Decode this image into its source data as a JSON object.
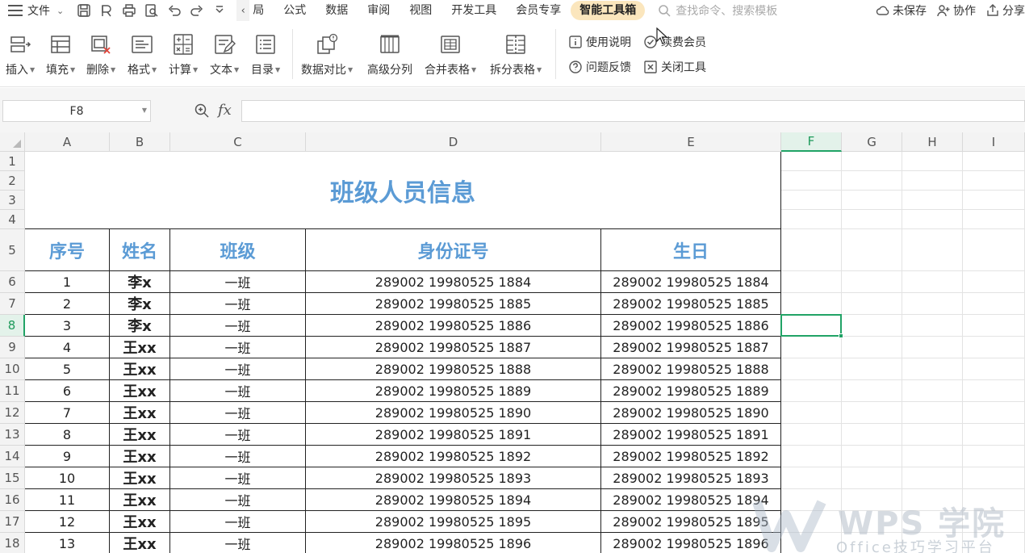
{
  "menubar": {
    "file_label": "文件",
    "tabs": [
      "页面布局",
      "公式",
      "数据",
      "审阅",
      "视图",
      "开发工具",
      "会员专享",
      "智能工具箱"
    ],
    "first_tab_visible": "局",
    "active_tab": "智能工具箱",
    "search_placeholder": "查找命令、搜索模板",
    "unsaved_label": "未保存",
    "collab_label": "协作",
    "share_label": "分享"
  },
  "ribbon": {
    "buttons": [
      {
        "label": "插入",
        "icon": "insert-rows-icon",
        "dropdown": true
      },
      {
        "label": "填充",
        "icon": "fill-icon",
        "dropdown": true
      },
      {
        "label": "删除",
        "icon": "delete-icon",
        "dropdown": true
      },
      {
        "label": "格式",
        "icon": "format-icon",
        "dropdown": true
      },
      {
        "label": "计算",
        "icon": "calculator-icon",
        "dropdown": true
      },
      {
        "label": "文本",
        "icon": "text-edit-icon",
        "dropdown": true
      },
      {
        "label": "目录",
        "icon": "toc-icon",
        "dropdown": true
      },
      {
        "label": "数据对比",
        "icon": "data-compare-icon",
        "dropdown": true
      },
      {
        "label": "高级分列",
        "icon": "split-columns-icon",
        "dropdown": false
      },
      {
        "label": "合并表格",
        "icon": "merge-table-icon",
        "dropdown": true
      },
      {
        "label": "拆分表格",
        "icon": "split-table-icon",
        "dropdown": true
      }
    ],
    "help_label": "使用说明",
    "renew_label": "续费会员",
    "feedback_label": "问题反馈",
    "close_label": "关闭工具"
  },
  "formula_bar": {
    "name_box": "F8",
    "fx_label": "fx",
    "formula": ""
  },
  "sheet": {
    "columns": [
      "A",
      "B",
      "C",
      "D",
      "E",
      "F",
      "G",
      "H",
      "I"
    ],
    "selected_column": "F",
    "row_numbers": [
      "1",
      "2",
      "3",
      "4",
      "5",
      "6",
      "7",
      "8",
      "9",
      "10",
      "11",
      "12",
      "13",
      "14",
      "15",
      "16",
      "17",
      "18"
    ],
    "selected_row": "8",
    "title": "班级人员信息",
    "headers": [
      "序号",
      "姓名",
      "班级",
      "身份证号",
      "生日"
    ],
    "rows": [
      [
        "1",
        "李x",
        "一班",
        "289002 19980525 1884",
        "289002 19980525 1884"
      ],
      [
        "2",
        "李x",
        "一班",
        "289002 19980525 1885",
        "289002 19980525 1885"
      ],
      [
        "3",
        "李x",
        "一班",
        "289002 19980525 1886",
        "289002 19980525 1886"
      ],
      [
        "4",
        "王xx",
        "一班",
        "289002 19980525 1887",
        "289002 19980525 1887"
      ],
      [
        "5",
        "王xx",
        "一班",
        "289002 19980525 1888",
        "289002 19980525 1888"
      ],
      [
        "6",
        "王xx",
        "一班",
        "289002 19980525 1889",
        "289002 19980525 1889"
      ],
      [
        "7",
        "王xx",
        "一班",
        "289002 19980525 1890",
        "289002 19980525 1890"
      ],
      [
        "8",
        "王xx",
        "一班",
        "289002 19980525 1891",
        "289002 19980525 1891"
      ],
      [
        "9",
        "王xx",
        "一班",
        "289002 19980525 1892",
        "289002 19980525 1892"
      ],
      [
        "10",
        "王xx",
        "一班",
        "289002 19980525 1893",
        "289002 19980525 1893"
      ],
      [
        "11",
        "王xx",
        "一班",
        "289002 19980525 1894",
        "289002 19980525 1894"
      ],
      [
        "12",
        "王xx",
        "一班",
        "289002 19980525 1895",
        "289002 19980525 1895"
      ],
      [
        "13",
        "王xx",
        "一班",
        "289002 19980525 1896",
        "289002 19980525 1896"
      ]
    ]
  },
  "watermark": {
    "brand": "WPS 学院",
    "sub": "Office技巧学习平台"
  },
  "colors": {
    "accent_green": "#21a366",
    "header_blue": "#5b9bd5",
    "active_tab_bg": "#fbe6bd"
  }
}
